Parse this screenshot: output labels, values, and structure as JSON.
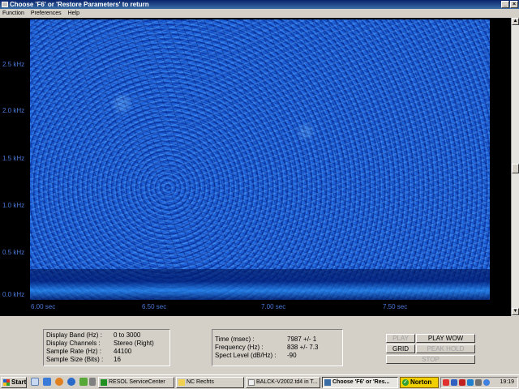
{
  "window": {
    "title": "Choose 'F6' or 'Restore Parameters' to return",
    "min_icon": "minimize-icon",
    "close_icon": "close-icon",
    "min_glyph": "_",
    "close_glyph": "×"
  },
  "menu": [
    "Function",
    "Preferences",
    "Help"
  ],
  "spectrogram": {
    "y_ticks": [
      "2.5 kHz",
      "2.0 kHz",
      "1.5 kHz",
      "1.0 kHz",
      "0.5 kHz",
      "0.0 kHz"
    ],
    "x_ticks": [
      "6.00 sec",
      "6.50 sec",
      "7.00 sec",
      "7.50 sec"
    ],
    "colors": {
      "background": "#000000",
      "field": "#1a56cc",
      "label": "#4a78d8"
    }
  },
  "settings": {
    "display_band_label": "Display Band (Hz) :",
    "display_band_value": "0 to 3000",
    "display_channels_label": "Display Channels :",
    "display_channels_value": "Stereo (Right)",
    "sample_rate_label": "Sample Rate (Hz) :",
    "sample_rate_value": "44100",
    "sample_size_label": "Sample Size (Bits) :",
    "sample_size_value": "16"
  },
  "readout": {
    "time_label": "Time (msec) :",
    "time_value": "7987 +/- 1",
    "freq_label": "Frequency (Hz) :",
    "freq_value": "838  +/- 7.3",
    "level_label": "Spect Level (dB/Hz) :",
    "level_value": "-90"
  },
  "controls": {
    "play": "PLAY",
    "play_wow": "PLAY WOW",
    "grid": "GRID",
    "peak_hold": "PEAK HOLD",
    "stop": "STOP"
  },
  "taskbar": {
    "start": "Start",
    "tasks": [
      {
        "label": "RESOL ServiceCenter",
        "icon": "resol-icon"
      },
      {
        "label": "NC Rechts",
        "icon": "folder-icon"
      },
      {
        "label": "BALCK-V2002.td4 in T...",
        "icon": "document-icon"
      },
      {
        "label": "Choose 'F6' or 'Res...",
        "icon": "app-window-icon"
      }
    ],
    "norton": "Norton",
    "clock": "19:19"
  }
}
